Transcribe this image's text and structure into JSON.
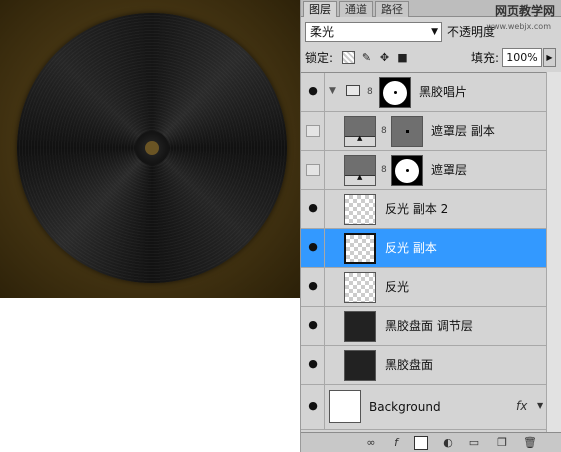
{
  "panel": {
    "tabs": [
      "图层",
      "通道",
      "路径"
    ],
    "active_tab": 0,
    "watermark": "网页教学网",
    "watermark_url": "www.webjx.com"
  },
  "blend": {
    "mode": "柔光",
    "opacity_label": "不透明度"
  },
  "lock": {
    "label": "锁定:",
    "fill_label": "填充:",
    "fill_value": "100%"
  },
  "layers": [
    {
      "name": "黑胶唱片",
      "visible": true,
      "type": "group"
    },
    {
      "name": "遮罩层 副本",
      "visible": false,
      "type": "masked"
    },
    {
      "name": "遮罩层",
      "visible": false,
      "type": "masked"
    },
    {
      "name": "反光 副本 2",
      "visible": true,
      "type": "transparent"
    },
    {
      "name": "反光 副本",
      "visible": true,
      "type": "transparent",
      "selected": true
    },
    {
      "name": "反光",
      "visible": true,
      "type": "transparent"
    },
    {
      "name": "黑胶盘面 调节层",
      "visible": true,
      "type": "dark"
    },
    {
      "name": "黑胶盘面",
      "visible": true,
      "type": "dark"
    },
    {
      "name": "Background",
      "visible": true,
      "type": "white"
    }
  ],
  "fx_label": "fx"
}
